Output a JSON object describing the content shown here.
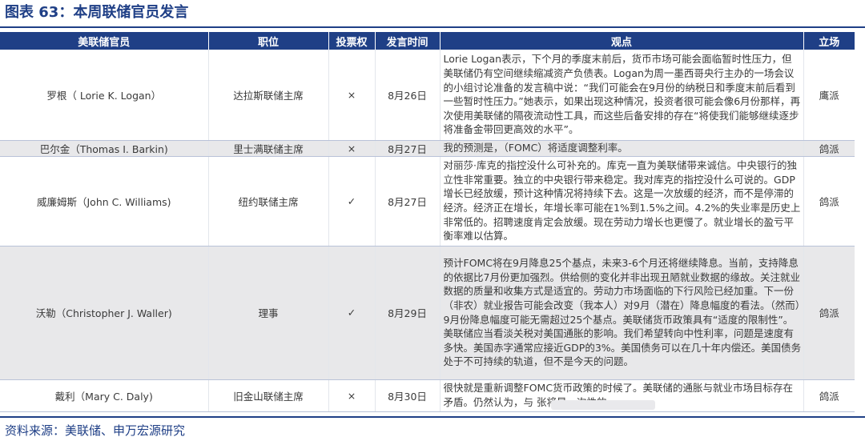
{
  "title": "图表 63：本周联储官员发言",
  "columns": [
    "美联储官员",
    "职位",
    "投票权",
    "发言时间",
    "观点",
    "立场"
  ],
  "rows": [
    {
      "official": "罗根（ Lorie K. Logan）",
      "position": "达拉斯联储主席",
      "vote": "×",
      "date": "8月26日",
      "view": "Lorie Logan表示，下个月的季度末前后，货币市场可能会面临暂时性压力，但美联储仍有空间继续缩减资产负债表。Logan为周一墨西哥央行主办的一场会议的小组讨论准备的发言稿中说：“我们可能会在9月份的纳税日和季度末前后看到一些暂时性压力。”她表示，如果出现这种情况，投资者很可能会像6月份那样，再次使用美联储的隔夜流动性工具，而这些后备安排的存在“将使我们能够继续逐步将准备金带回更高效的水平”。",
      "stance": "鹰派"
    },
    {
      "official": "巴尔金（Thomas I. Barkin)",
      "position": "里士满联储主席",
      "vote": "×",
      "date": "8月27日",
      "view": "我的预测是，（FOMC）将适度调整利率。",
      "stance": "鸽派"
    },
    {
      "official": "威廉姆斯（John C. Williams)",
      "position": "纽约联储主席",
      "vote": "✓",
      "date": "8月27日",
      "view": "对丽莎·库克的指控没什么可补充的。库克一直为美联储带来诚信。中央银行的独立性非常重要。独立的中央银行带来稳定。我对库克的指控没什么可说的。GDP增长已经放缓，预计这种情况将持续下去。这是一次放缓的经济，而不是停滞的经济。经济正在增长，年增长率可能在1%到1.5%之间。4.2%的失业率是历史上非常低的。招聘速度肯定会放缓。现在劳动力增长也更慢了。就业增长的盈亏平衡率难以估算。",
      "stance": "鸽派"
    },
    {
      "official": "沃勒（Christopher J. Waller)",
      "position": "理事",
      "vote": "✓",
      "date": "8月29日",
      "view": "预计FOMC将在9月降息25个基点，未来3-6个月还将继续降息。当前，支持降息的依据比7月份更加强烈。供给侧的变化并非出现丑陋就业数据的缘故。关注就业数据的质量和收集方式是适宜的。劳动力市场面临的下行风险已经加重。下一份（非农）就业报告可能会改变（我本人）对9月（潜在）降息幅度的看法。（然而）9月份降息幅度可能无需超过25个基点。美联储货币政策具有“适度的限制性”。美联储应当看淡关税对美国通胀的影响。我们希望转向中性利率，问题是速度有多快。美国赤字通常应接近GDP的3%。美国债务可以在几十年内偿还。美国债务处于不可持续的轨道，但不是今天的问题。",
      "stance": "鸽派"
    },
    {
      "official": "戴利（Mary C. Daly)",
      "position": "旧金山联储主席",
      "vote": "×",
      "date": "8月30日",
      "view": "很快就是重新调整FOMC货币政策的时候了。美联储的通胀与就业市场目标存在矛盾。仍然认为，与                    张将是一次性的。",
      "stance": "鸽派"
    }
  ],
  "source": "资料来源：美联储、申万宏源研究",
  "colors": {
    "header_bg": "#1f3f86",
    "alt_row_bg": "#e8e8ea"
  }
}
